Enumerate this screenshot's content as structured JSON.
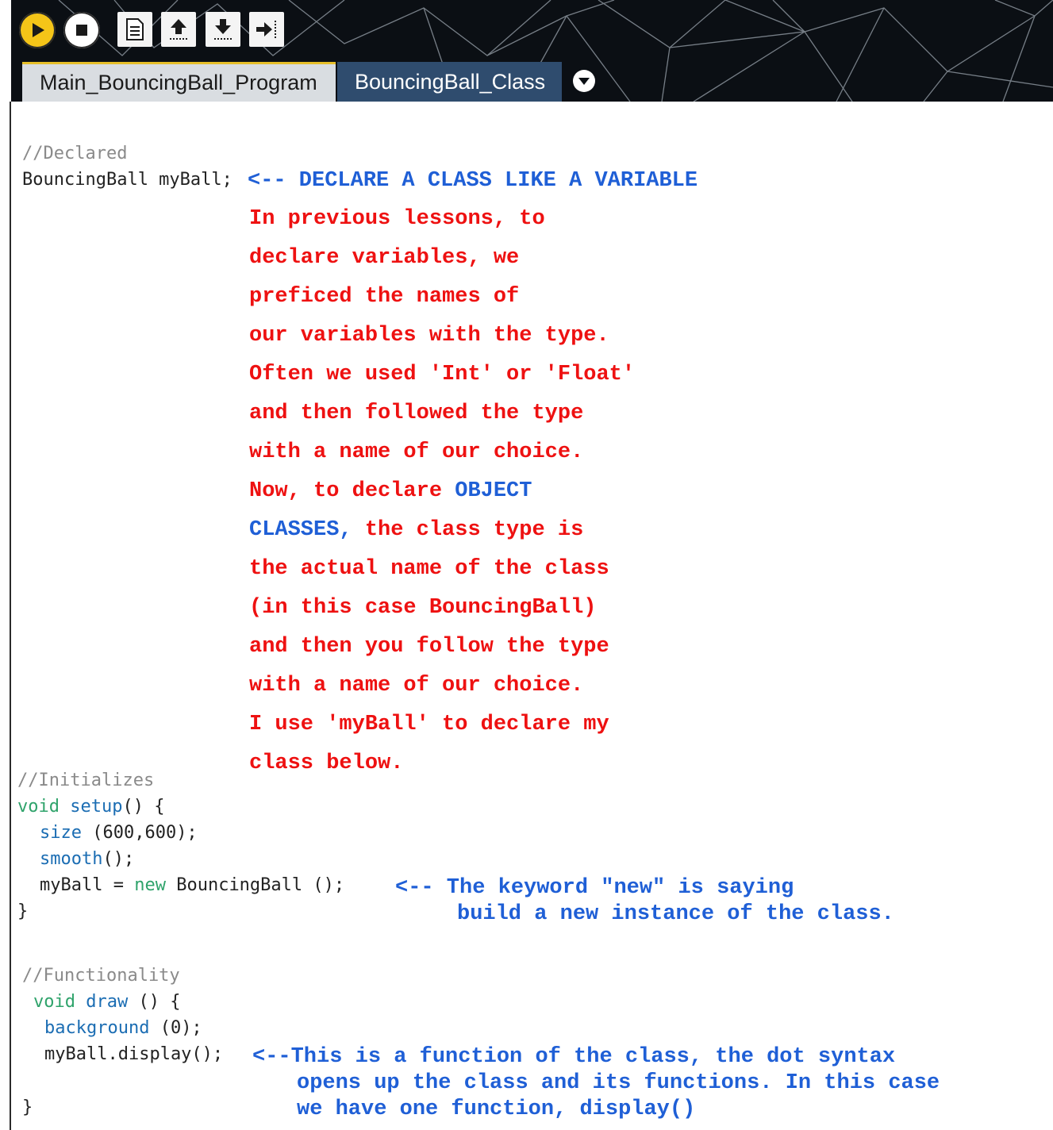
{
  "toolbar": {
    "run_icon": "play-icon",
    "stop_icon": "stop-icon",
    "new_icon": "new-file-icon",
    "open_icon": "open-upload-icon",
    "save_icon": "save-download-icon",
    "export_icon": "export-icon",
    "run_color": "#f5c518"
  },
  "tabs": [
    {
      "label": "Main_BouncingBall_Program",
      "active": true
    },
    {
      "label": "BouncingBall_Class",
      "active": false
    }
  ],
  "tab_menu_icon": "chevron-down-icon",
  "code": {
    "c1": "//Declared",
    "decl": "BouncingBall myBall;",
    "c2": "//Initializes",
    "setup_kw": "void",
    "setup_name": "setup",
    "setup_rest": "() {",
    "size_fn": "size",
    "size_args": " (600,600);",
    "smooth_fn": "smooth",
    "smooth_rest": "();",
    "assign_a": "myBall = ",
    "assign_new": "new",
    "assign_b": " BouncingBall ();",
    "close1": "}",
    "c3": "//Functionality",
    "draw_kw": "void",
    "draw_name": "draw",
    "draw_rest": " () {",
    "bg_fn": "background",
    "bg_args": " (0);",
    "display_call": "myBall.display();",
    "close2": "}"
  },
  "notes": {
    "declare_arrow": "<-- DECLARE A CLASS LIKE A VARIABLE",
    "lines": [
      "In previous lessons, to",
      "declare variables, we",
      "preficed the names of",
      "our variables with the type.",
      "Often we used 'Int' or 'Float'",
      "and then followed the type",
      "with a name of our choice."
    ],
    "now_red": "Now, to declare ",
    "now_blue": "OBJECT",
    "classes_blue": "CLASSES,",
    "classes_red": " the class type is",
    "lines2": [
      "the actual name of the class",
      "(in this case BouncingBall)",
      "and then you follow the type",
      "with a name of our choice.",
      "I use 'myBall' to declare my",
      "class below."
    ],
    "new_note_1": "<-- The keyword \"new\" is saying",
    "new_note_2": "build a new instance of the class.",
    "func_note_1": "<--This is a function of the class, the dot syntax",
    "func_note_2": "opens up the class and its functions. In this case",
    "func_note_3": "we have one function, display()"
  }
}
